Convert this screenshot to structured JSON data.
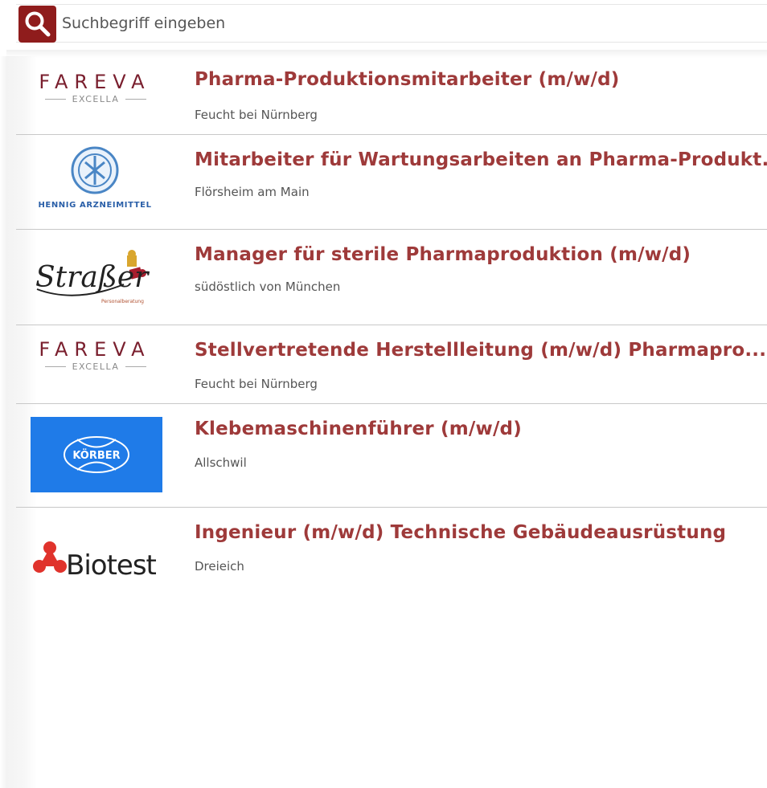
{
  "search": {
    "placeholder": "Suchbegriff eingeben",
    "value": ""
  },
  "jobs": [
    {
      "title": "Pharma-Produktionsmitarbeiter (m/w/d)",
      "location": "Feucht bei Nürnberg",
      "company_logo": "FAREVA",
      "logo_sub": "EXCELLA"
    },
    {
      "title": "Mitarbeiter für Wartungsarbeiten an Pharma-Produkt...",
      "location": "Flörsheim am Main",
      "company_logo": "HENNIG ARZNEIMITTEL"
    },
    {
      "title": "Manager für sterile Pharmaproduktion (m/w/d)",
      "location": "südöstlich von München",
      "company_logo": "Straßer",
      "logo_sub": "Personalberatung"
    },
    {
      "title": "Stellvertretende Herstellleitung (m/w/d) Pharmapro...",
      "location": "Feucht bei Nürnberg",
      "company_logo": "FAREVA",
      "logo_sub": "EXCELLA"
    },
    {
      "title": "Klebemaschinenführer (m/w/d)",
      "location": "Allschwil",
      "company_logo": "KÖRBER"
    },
    {
      "title": "Ingenieur (m/w/d) Technische Gebäudeausrüstung",
      "location": "Dreieich",
      "company_logo": "Biotest"
    }
  ],
  "colors": {
    "accent": "#8f1c1c",
    "title": "#9e3a3a",
    "koerber_blue": "#1f7be8"
  }
}
